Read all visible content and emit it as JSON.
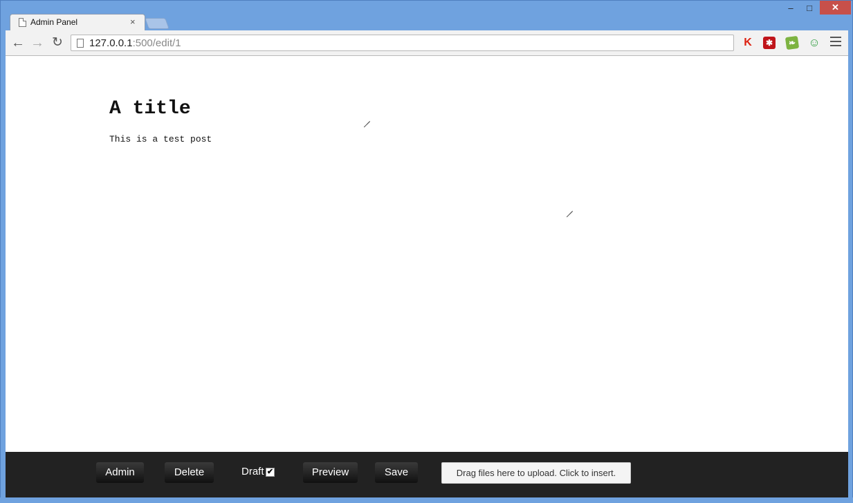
{
  "window": {
    "minimize_glyph": "‒",
    "maximize_glyph": "□",
    "close_glyph": "✕"
  },
  "tab": {
    "title": "Admin Panel",
    "close_glyph": "×"
  },
  "toolbar": {
    "back_glyph": "←",
    "forward_glyph": "→",
    "reload_glyph": "↻",
    "url_host": "127.0.0.1",
    "url_rest": ":500/edit/1",
    "extensions": [
      "kaspersky-icon",
      "lastpass-icon",
      "evernote-icon",
      "extension-icon"
    ],
    "ext_glyphs": [
      "K",
      "✱",
      "❧",
      "☺"
    ]
  },
  "editor": {
    "title": "A title",
    "body": "This is a test post"
  },
  "actions": {
    "admin_label": "Admin",
    "delete_label": "Delete",
    "draft_label": "Draft",
    "draft_checked": true,
    "draft_check_glyph": "✔",
    "preview_label": "Preview",
    "save_label": "Save",
    "upload_text": "Drag files here to upload. Click to insert."
  },
  "colors": {
    "frame": "#6fa2df",
    "close_button": "#c7504a",
    "actionbar": "#222222"
  }
}
